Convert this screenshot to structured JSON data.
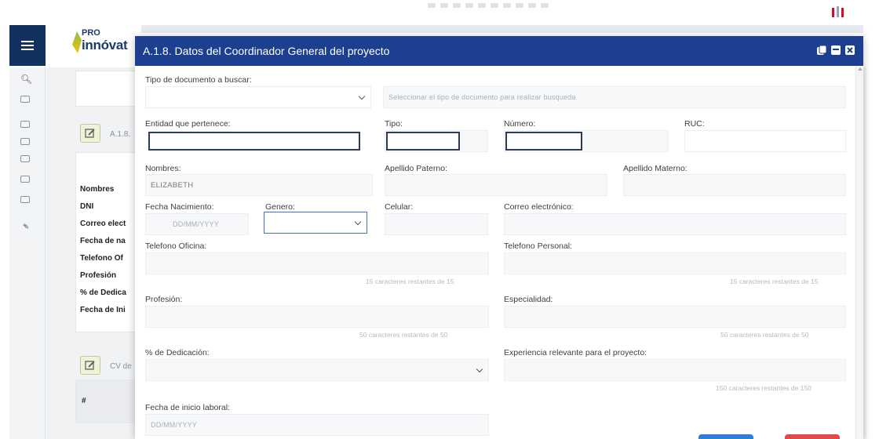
{
  "modal": {
    "title": "A.1.8. Datos del Coordinador General del proyecto",
    "header_icons": [
      "copy-icon",
      "minimize-icon",
      "close-icon"
    ]
  },
  "brand": {
    "line1": "PRO",
    "line2": "innóvat"
  },
  "background": {
    "section1_label": "A.1.8.",
    "section2_label": "CV de",
    "summary_labels": [
      "Nombres",
      "DNI",
      "Correo elect",
      "Fecha de na",
      "Telefono Of",
      "Profesión",
      "% de Dedica",
      "Fecha de Ini"
    ],
    "table_header": "#"
  },
  "form": {
    "tipo_doc": {
      "label": "Tipo de documento a buscar:",
      "hint": "Seleccionar el tipo de documento para realizar busqueda"
    },
    "entidad": {
      "label": "Entidad que pertenece:"
    },
    "tipo": {
      "label": "Tipo:"
    },
    "numero": {
      "label": "Número:"
    },
    "ruc": {
      "label": "RUC:"
    },
    "nombres": {
      "label": "Nombres:",
      "value": "ELIZABETH"
    },
    "apellido_paterno": {
      "label": "Apellido Paterno:"
    },
    "apellido_materno": {
      "label": "Apellido Materno:"
    },
    "fecha_nacimiento": {
      "label": "Fecha Nacimiento:",
      "placeholder": "DD/MM/YYYY"
    },
    "genero": {
      "label": "Genero:"
    },
    "celular": {
      "label": "Celular:"
    },
    "correo": {
      "label": "Correo electrónico:"
    },
    "telefono_oficina": {
      "label": "Telefono Oficina:",
      "counter": "15 caracteres restantes de 15"
    },
    "telefono_personal": {
      "label": "Telefono Personal:",
      "counter": "15 caracteres restantes de 15"
    },
    "profesion": {
      "label": "Profesión:",
      "counter": "50 caracteres restantes de 50"
    },
    "especialidad": {
      "label": "Especialidad:",
      "counter": "50 caracteres restantes de 50"
    },
    "dedicacion": {
      "label": "% de Dedicación:"
    },
    "experiencia": {
      "label": "Experiencia relevante para el proyecto:",
      "counter": "150 caracteres restantes de 150"
    },
    "fecha_inicio": {
      "label": "Fecha de inicio laboral:",
      "placeholder": "DD/MM/YYYY"
    }
  },
  "colors": {
    "header": "#1c3f8f",
    "menu": "#11315f"
  }
}
